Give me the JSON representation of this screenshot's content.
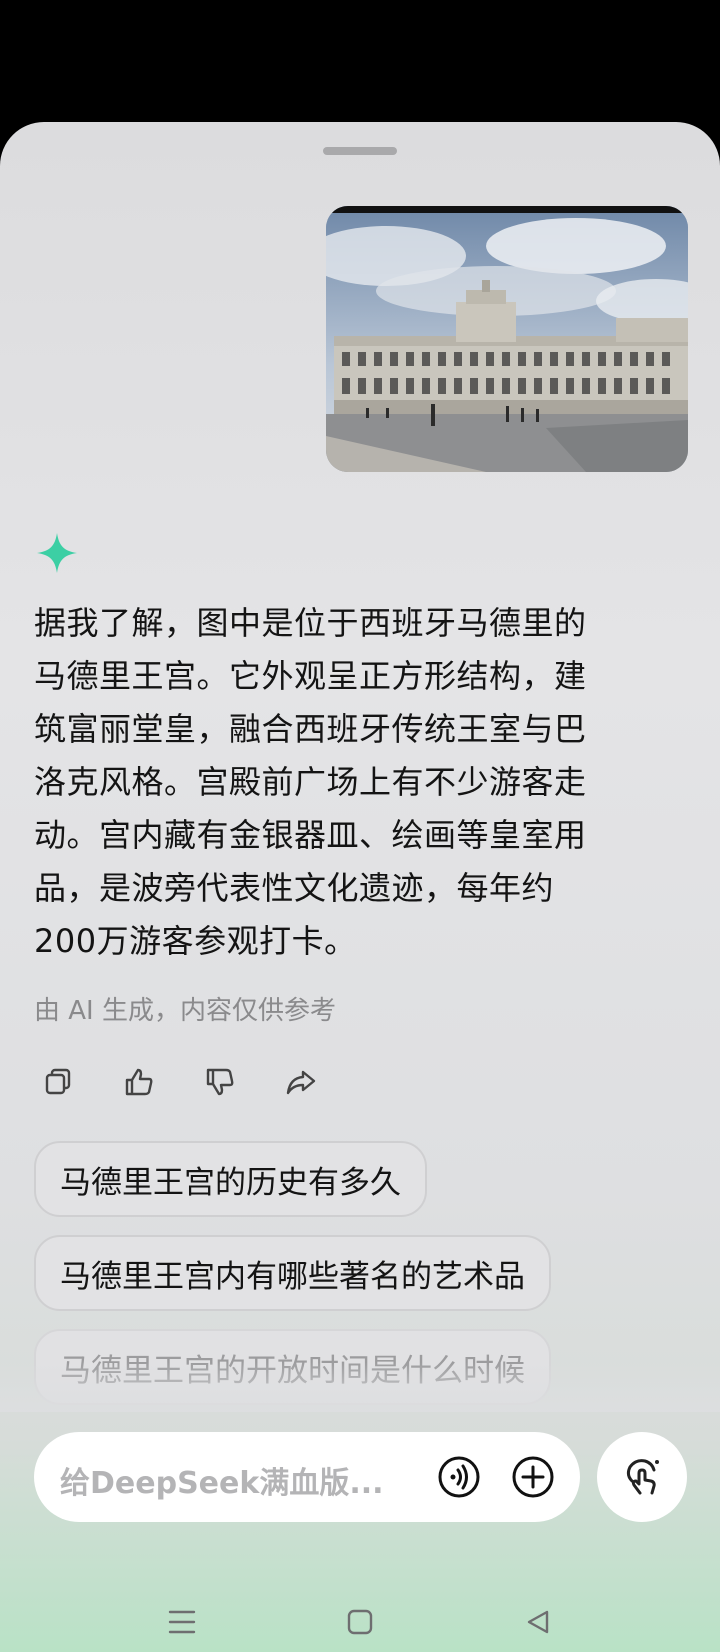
{
  "photo": {
    "alt": "Royal Palace of Madrid photo"
  },
  "answer": {
    "lines": [
      "据我了解，图中是位于西班牙马德里的",
      "马德里王宫。它外观呈正方形结构，建",
      "筑富丽堂皇，融合西班牙传统王室与巴",
      "洛克风格。宫殿前广场上有不少游客走",
      "动。宫内藏有金银器皿、绘画等皇室用",
      "品，是波旁代表性文化遗迹，每年约",
      "200万游客参观打卡。"
    ],
    "disclaimer": "由 AI 生成，内容仅供参考"
  },
  "actions": {
    "icons": [
      "copy-icon",
      "thumbs-up-icon",
      "thumbs-down-icon",
      "share-icon"
    ]
  },
  "suggestions": [
    "马德里王宫的历史有多久",
    "马德里王宫内有哪些著名的艺术品",
    "马德里王宫的开放时间是什么时候"
  ],
  "input": {
    "placeholder": "给DeepSeek满血版..."
  },
  "colors": {
    "sparkle": "#3ccfa4",
    "text": "#141414",
    "muted": "#8a8a8c"
  }
}
